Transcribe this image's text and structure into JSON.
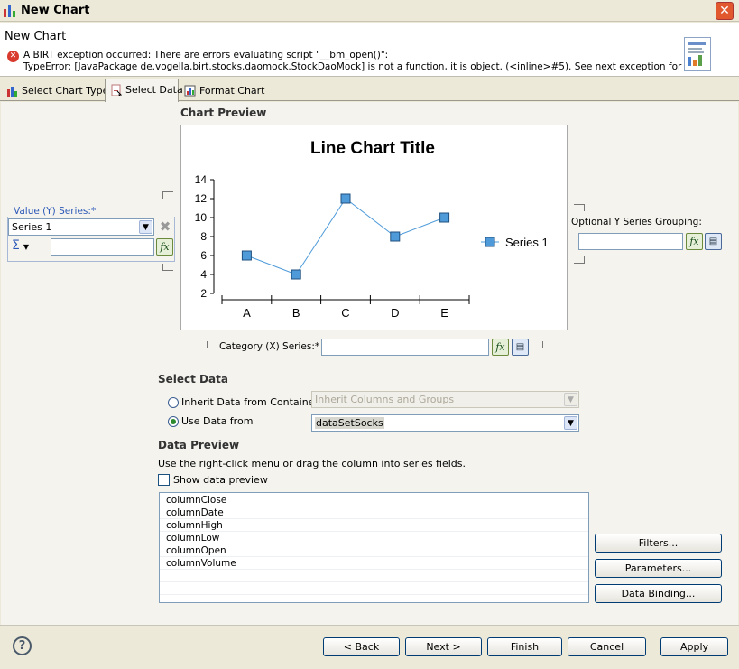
{
  "window": {
    "title": "New Chart",
    "close_label": "✕"
  },
  "header": {
    "title": "New Chart",
    "error_line1": "A BIRT exception occurred: There are errors evaluating script \"__bm_open()\":",
    "error_line2": "TypeError: [JavaPackage de.vogella.birt.stocks.daomock.StockDaoMock] is not a function, it is object. (<inline>#5). See next exception for more"
  },
  "tabs": [
    {
      "label": "Select Chart Type"
    },
    {
      "label": "Select Data"
    },
    {
      "label": "Format Chart"
    }
  ],
  "preview": {
    "section_label": "Chart Preview"
  },
  "chart_data": {
    "type": "line",
    "title": "Line Chart Title",
    "categories": [
      "A",
      "B",
      "C",
      "D",
      "E"
    ],
    "series": [
      {
        "name": "Series 1",
        "values": [
          6,
          4,
          12,
          8,
          10
        ]
      }
    ],
    "y_ticks": [
      "2",
      "4",
      "6",
      "8",
      "10",
      "12",
      "14"
    ],
    "ylim": [
      2,
      14
    ],
    "legend_position": "right",
    "series_color": "#4f9bd9"
  },
  "value_series": {
    "legend": "Value (Y) Series:*",
    "selected": "Series 1",
    "expression": "",
    "sigma": "Σ"
  },
  "optional_grouping": {
    "label": "Optional Y Series Grouping:",
    "value": ""
  },
  "category_series": {
    "label": "Category (X) Series:*",
    "value": ""
  },
  "select_data": {
    "section_label": "Select Data",
    "inherit_label": "Inherit Data from Container",
    "inherit_value": "Inherit Columns and Groups",
    "use_label": "Use Data from",
    "use_value": "dataSetSocks"
  },
  "data_preview": {
    "section_label": "Data Preview",
    "hint": "Use the right-click menu or drag the column into series fields.",
    "show_label": "Show data preview",
    "columns": [
      "columnClose",
      "columnDate",
      "columnHigh",
      "columnLow",
      "columnOpen",
      "columnVolume"
    ]
  },
  "side_buttons": {
    "filters": "Filters...",
    "parameters": "Parameters...",
    "data_binding": "Data Binding..."
  },
  "footer": {
    "help": "?",
    "back": "< Back",
    "next": "Next >",
    "finish": "Finish",
    "cancel": "Cancel",
    "apply": "Apply"
  }
}
